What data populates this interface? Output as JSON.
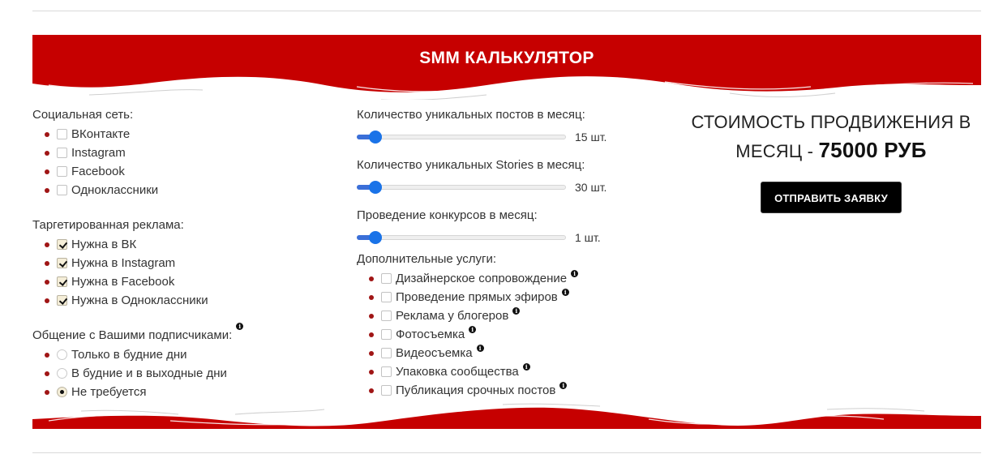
{
  "header": {
    "title": "SMM КАЛЬКУЛЯТОР",
    "brand_color": "#c60000"
  },
  "social": {
    "label": "Социальная сеть:",
    "items": [
      {
        "label": "ВКонтакте",
        "checked": false
      },
      {
        "label": "Instagram",
        "checked": false
      },
      {
        "label": "Facebook",
        "checked": false
      },
      {
        "label": "Одноклассники",
        "checked": false
      }
    ]
  },
  "ads": {
    "label": "Таргетированная реклама:",
    "items": [
      {
        "label": "Нужна в ВК",
        "checked": true
      },
      {
        "label": "Нужна в Instagram",
        "checked": true
      },
      {
        "label": "Нужна в Facebook",
        "checked": true
      },
      {
        "label": "Нужна в Одноклассники",
        "checked": true
      }
    ]
  },
  "communication": {
    "label": "Общение с Вашими подписчиками:",
    "info_icon": "info-icon",
    "items": [
      {
        "label": "Только в будние дни",
        "selected": false
      },
      {
        "label": "В будние и в выходные дни",
        "selected": false
      },
      {
        "label": "Не требуется",
        "selected": true
      }
    ]
  },
  "sliders": [
    {
      "label": "Количество уникальных постов в месяц:",
      "value_text": "15 шт.",
      "fraction": 0.06
    },
    {
      "label": "Количество уникальных Stories в месяц:",
      "value_text": "30 шт.",
      "fraction": 0.06
    },
    {
      "label": "Проведение конкурсов в месяц:",
      "value_text": "1 шт.",
      "fraction": 0.06
    }
  ],
  "extras": {
    "label": "Дополнительные услуги:",
    "items": [
      {
        "label": "Дизайнерское сопровождение",
        "checked": false
      },
      {
        "label": "Проведение прямых эфиров",
        "checked": false
      },
      {
        "label": "Реклама у блогеров",
        "checked": false
      },
      {
        "label": "Фотосъемка",
        "checked": false
      },
      {
        "label": "Видеосъемка",
        "checked": false
      },
      {
        "label": "Упаковка сообщества",
        "checked": false
      },
      {
        "label": "Публикация срочных постов",
        "checked": false
      }
    ]
  },
  "result": {
    "line1": "СТОИМОСТЬ ПРОДВИЖЕНИЯ В",
    "line2": "МЕСЯЦ - ",
    "amount": "75000 РУБ",
    "submit_label": "ОТПРАВИТЬ ЗАЯВКУ"
  }
}
